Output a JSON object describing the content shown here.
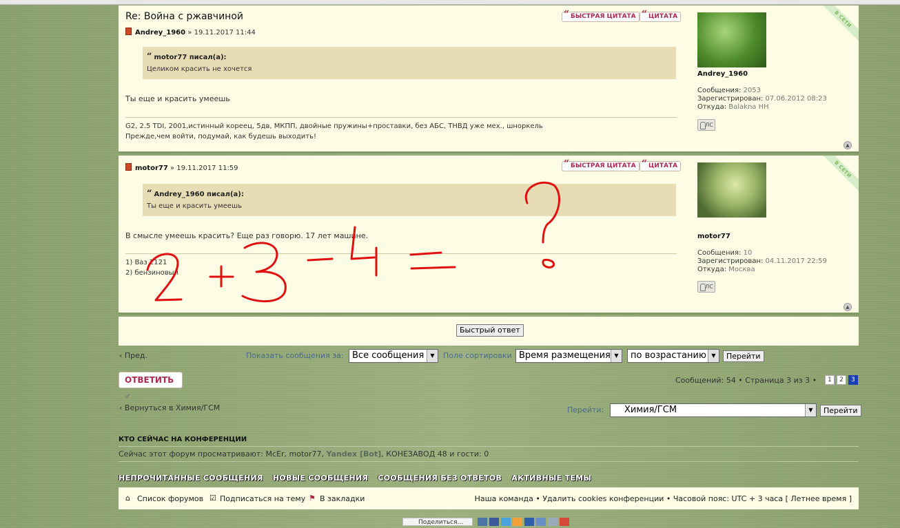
{
  "posts": [
    {
      "title": "Re: Война с ржавчиной",
      "author": "Andrey_1960",
      "date": "» 19.11.2017 11:44",
      "quick_quote": "БЫСТРАЯ ЦИТАТА",
      "quote": "ЦИТАТА",
      "quoted_author": "motor77 писал(а):",
      "quoted_text": "Целиком красить не хочется",
      "text": "Ты еще и красить умеешь",
      "signature": [
        "G2, 2.5 TDI, 2001,истинный кореец, 5дв, МКПП, двойные пружины+проставки, без АБС, ТНВД уже мех., шноркель",
        "Прежде,чем войти, подумай, как будешь выходить!"
      ],
      "profile": {
        "online": "В СЕТИ",
        "username": "Andrey_1960",
        "messages_label": "Сообщения:",
        "messages": "2053",
        "registered_label": "Зарегистрирован:",
        "registered": "07.06.2012 08:23",
        "from_label": "Откуда:",
        "from": "Balakna НН",
        "pm": "ЛС"
      }
    },
    {
      "author": "motor77",
      "date": "» 19.11.2017 11:59",
      "quick_quote": "БЫСТРАЯ ЦИТАТА",
      "quote": "ЦИТАТА",
      "quoted_author": "Andrey_1960 писал(а):",
      "quoted_text": "Ты еще и красить умеешь",
      "text": "В смысле умеешь красить? Еще раз говорю. 17 лет машине.",
      "signature": [
        "1) Ваз 2121",
        "2) бензиновый"
      ],
      "profile": {
        "online": "В СЕТИ",
        "username": "motor77",
        "messages_label": "Сообщения:",
        "messages": "10",
        "registered_label": "Зарегистрирован:",
        "registered": "04.11.2017 22:59",
        "from_label": "Откуда:",
        "from": "Москва",
        "pm": "ЛС"
      }
    }
  ],
  "quick_reply": "Быстрый ответ",
  "sort_bar": {
    "prev": "‹ Пред.",
    "show_label": "Показать сообщения за:",
    "show_value": "Все сообщения",
    "sort_label": "Поле сортировки",
    "sort_value": "Время размещения",
    "order_value": "по возрастанию",
    "go": "Перейти"
  },
  "reply_button": "ОТВЕТИТЬ",
  "pagination": {
    "summary": "Сообщений: 54 • Страница 3 из 3 •",
    "pages": [
      "1",
      "2",
      "3"
    ],
    "current": "3"
  },
  "back_link": "‹ Вернуться в Химия/ГСМ",
  "jump": {
    "label": "Перейти:",
    "value": "Химия/ГСМ",
    "go": "Перейти"
  },
  "whois": {
    "heading": "КТО СЕЙЧАС НА КОНФЕРЕНЦИИ",
    "prefix": "Сейчас этот форум просматривают: McEr, motor77,",
    "bot": "Yandex [Bot]",
    "suffix": ", КОНЕЗАВОД 48 и гости: 0"
  },
  "nav_links": [
    "НЕПРОЧИТАННЫЕ СООБЩЕНИЯ",
    "НОВЫЕ СООБЩЕНИЯ",
    "СООБЩЕНИЯ БЕЗ ОТВЕТОВ",
    "АКТИВНЫЕ ТЕМЫ"
  ],
  "footer": {
    "forum_list": "Список форумов",
    "subscribe": "Подписаться на тему",
    "bookmark": "В закладки",
    "right": "Наша команда • Удалить cookies конференции • Часовой пояс: UTC + 3 часа [ Летнее время ]"
  },
  "share": {
    "label": "Поделиться…"
  },
  "colors": {
    "post_bg": "#fdfce4",
    "quote_bg": "#e8dcb4",
    "accent": "#a82a50",
    "scribble": "#e01010"
  }
}
